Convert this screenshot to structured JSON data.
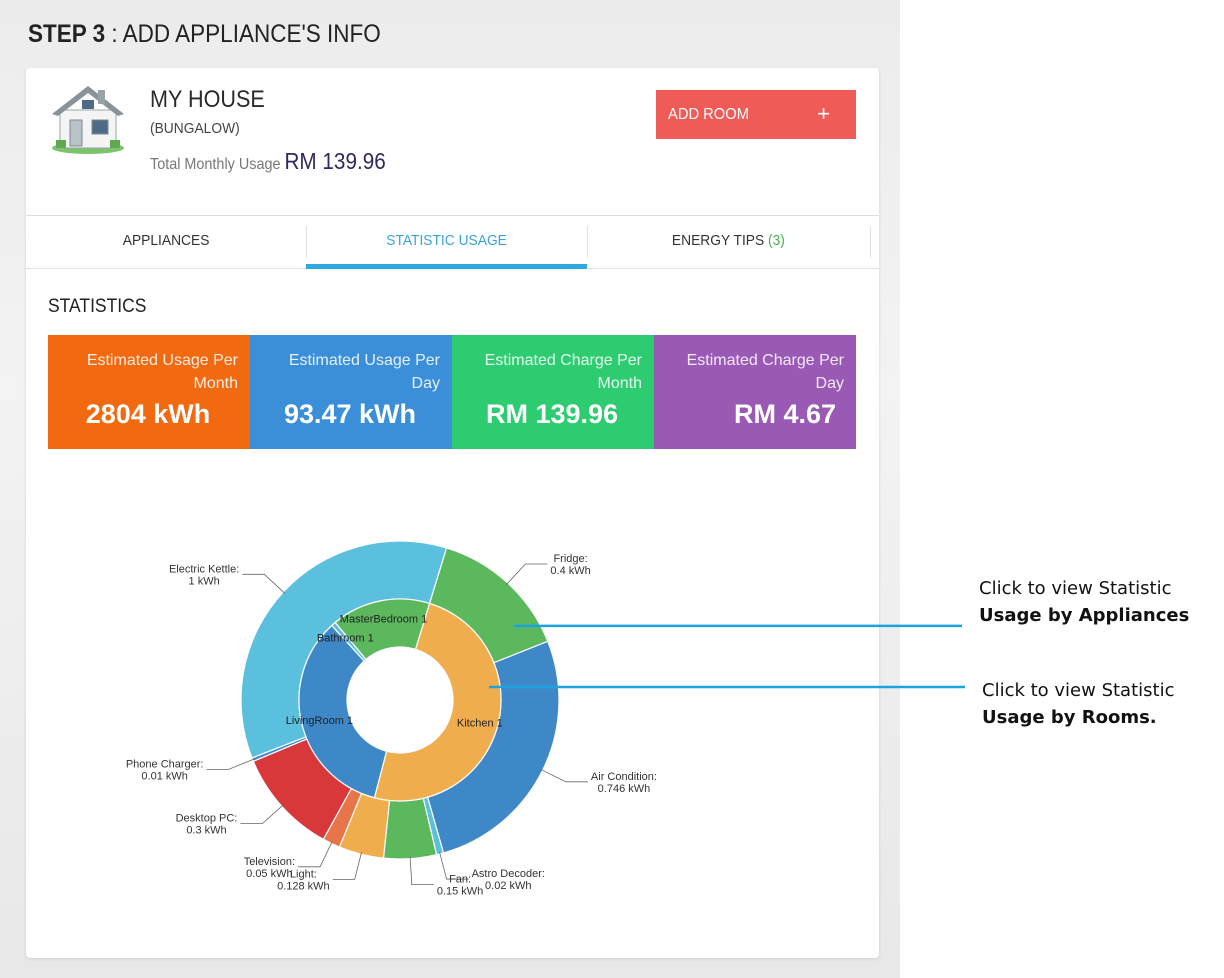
{
  "page": {
    "step_label": "STEP 3",
    "step_title": " : ADD APPLIANCE'S INFO"
  },
  "house": {
    "name": "MY HOUSE",
    "type": "(BUNGALOW)",
    "usage_label": "Total Monthly Usage",
    "usage_value": "RM 139.96",
    "icon": "house-icon"
  },
  "actions": {
    "add_room_label": "ADD ROOM",
    "add_room_icon": "+"
  },
  "tabs": [
    {
      "label": "APPLIANCES",
      "active": false
    },
    {
      "label": "STATISTIC USAGE",
      "active": true
    },
    {
      "label": "ENERGY TIPS ",
      "count": "(3)",
      "active": false
    }
  ],
  "statistics": {
    "heading": "STATISTICS",
    "cards": [
      {
        "label_line1": "Estimated Usage Per",
        "label_line2": "Month",
        "value": "2804 kWh",
        "color": "#f26a10"
      },
      {
        "label_line1": "Estimated Usage Per",
        "label_line2": "Day",
        "value": "93.47 kWh",
        "color": "#3a8fd8"
      },
      {
        "label_line1": "Estimated Charge Per",
        "label_line2": "Month",
        "value": "RM 139.96",
        "color": "#2ecc71"
      },
      {
        "label_line1": "Estimated Charge Per",
        "label_line2": "Day",
        "value": "RM 4.67",
        "color": "#9b59b6"
      }
    ]
  },
  "chart_data": {
    "type": "pie",
    "subtype": "double-donut",
    "unit": "kWh",
    "outer_ring": [
      {
        "label": "Fridge:",
        "value_text": "0.4 kWh",
        "value": 0.4,
        "color": "#5cb85c"
      },
      {
        "label": "Air Condition:",
        "value_text": "0.746 kWh",
        "value": 0.746,
        "color": "#3f88c8"
      },
      {
        "label": "Astro Decoder:",
        "value_text": "0.02 kWh",
        "value": 0.02,
        "color": "#5bc0de"
      },
      {
        "label": "Fan:",
        "value_text": "0.15 kWh",
        "value": 0.15,
        "color": "#5cb85c"
      },
      {
        "label": "Light:",
        "value_text": "0.128 kWh",
        "value": 0.128,
        "color": "#f0ad4e"
      },
      {
        "label": "Television:",
        "value_text": "0.05 kWh",
        "value": 0.05,
        "color": "#e8744a"
      },
      {
        "label": "Desktop PC:",
        "value_text": "0.3 kWh",
        "value": 0.3,
        "color": "#d9383a"
      },
      {
        "label": "Phone Charger:",
        "value_text": "0.01 kWh",
        "value": 0.01,
        "color": "#3f88c8"
      },
      {
        "label": "Electric Kettle:",
        "value_text": "1 kWh",
        "value": 1.0,
        "color": "#5bc0de"
      }
    ],
    "inner_ring": [
      {
        "label": "Kitchen 1",
        "value": 1.374,
        "color": "#f0ad4e"
      },
      {
        "label": "LivingRoom 1",
        "value": 0.95,
        "color": "#3f88c8"
      },
      {
        "label": "Bathroom 1",
        "value": 0.02,
        "color": "#5bc0de"
      },
      {
        "label": "MasterBedroom 1",
        "value": 0.44,
        "color": "#5cb85c"
      }
    ]
  },
  "annotations": [
    {
      "line1": "Click to view Statistic",
      "line2": "Usage by Appliances"
    },
    {
      "line1": "Click to view Statistic",
      "line2": "Usage by Rooms."
    }
  ]
}
